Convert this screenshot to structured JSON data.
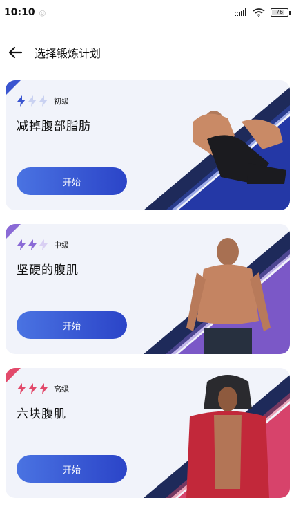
{
  "status_bar": {
    "time": "10:10",
    "battery_level": "76"
  },
  "header": {
    "title": "选择锻炼计划"
  },
  "plans": [
    {
      "level_label": "初级",
      "level_value": 1,
      "title": "减掉腹部脂肪",
      "button_label": "开始",
      "accent_color": "#3a55d0",
      "bolt_dim_color": "#c9d1f1",
      "stripe_color": "#2438a6"
    },
    {
      "level_label": "中级",
      "level_value": 2,
      "title": "坚硬的腹肌",
      "button_label": "开始",
      "accent_color": "#8a6ad6",
      "bolt_dim_color": "#d9cff3",
      "stripe_color": "#7b58c7"
    },
    {
      "level_label": "高级",
      "level_value": 3,
      "title": "六块腹肌",
      "button_label": "开始",
      "accent_color": "#e24a6b",
      "bolt_dim_color": "#f3c6d1",
      "stripe_color": "#d7436b"
    }
  ],
  "icons": {
    "back": "arrow-left-icon",
    "level": "lightning-bolt-icon",
    "wifi": "wifi-icon",
    "signal": "signal-icon",
    "battery": "battery-icon"
  }
}
